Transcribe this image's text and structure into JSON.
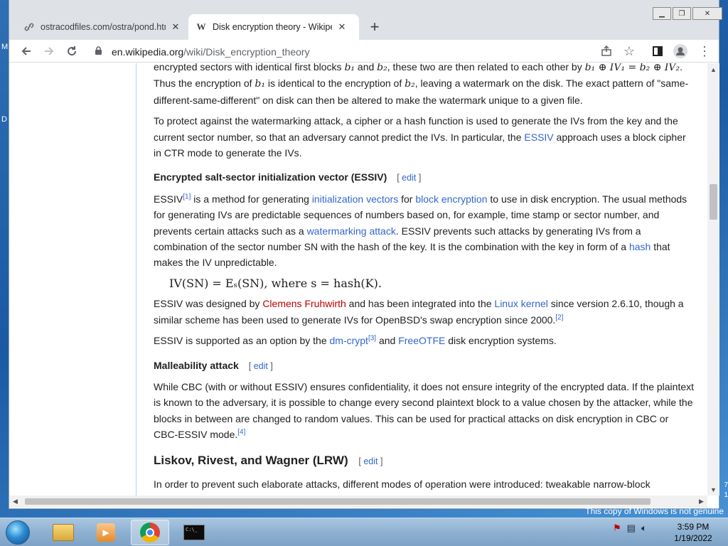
{
  "browser": {
    "tabs": [
      {
        "title": "ostracodfiles.com/ostra/pond.htm",
        "favicon": "link-icon"
      },
      {
        "title": "Disk encryption theory - Wikipedia",
        "favicon": "wikipedia-icon"
      }
    ],
    "new_tab": "+",
    "url_domain": "en.wikipedia.org",
    "url_path": "/wiki/Disk_encryption_theory"
  },
  "article": {
    "p0_a": "encrypted sectors with identical first blocks ",
    "p0_b": " and ",
    "p0_c": ", these two are then related to each other by ",
    "p0_eq": "b₁ ⊕ IV₁ = b₂ ⊕ IV₂",
    "p0_d": ". Thus the encryption of ",
    "p0_e": " is identical to the encryption of ",
    "p0_f": ", leaving a watermark on the disk. The exact pattern of \"same-different-same-different\" on disk can then be altered to make the watermark unique to a given file.",
    "b1": "b₁",
    "b2": "b₂",
    "p1_a": "To protect against the watermarking attack, a cipher or a hash function is used to generate the IVs from the key and the current sector number, so that an adversary cannot predict the IVs. In particular, the ",
    "p1_link": "ESSIV",
    "p1_b": " approach uses a block cipher in CTR mode to generate the IVs.",
    "h_essiv": "Encrypted salt-sector initialization vector (ESSIV)",
    "edit_open": "[",
    "edit_label": "edit",
    "edit_close": "]",
    "p2_a": "ESSIV",
    "p2_ref": "[1]",
    "p2_b": " is a method for generating ",
    "p2_link1": "initialization vectors",
    "p2_c": " for ",
    "p2_link2": "block encryption",
    "p2_d": " to use in disk encryption. The usual methods for generating IVs are predictable sequences of numbers based on, for example, time stamp or sector number, and prevents certain attacks such as a ",
    "p2_link3": "watermarking attack",
    "p2_e": ". ESSIV prevents such attacks by generating IVs from a combination of the sector number SN with the hash of the key. It is the combination with the key in form of a ",
    "p2_link4": "hash",
    "p2_f": " that makes the IV unpredictable.",
    "formula": "IV(SN) = Eₛ(SN),  where s = hash(K).",
    "p3_a": "ESSIV was designed by ",
    "p3_link1": "Clemens Fruhwirth",
    "p3_b": " and has been integrated into the ",
    "p3_link2": "Linux kernel",
    "p3_c": " since version 2.6.10, though a similar scheme has been used to generate IVs for OpenBSD's swap encryption since 2000.",
    "p3_ref": "[2]",
    "p4_a": "ESSIV is supported as an option by the ",
    "p4_link1": "dm-crypt",
    "p4_ref": "[3]",
    "p4_b": " and ",
    "p4_link2": "FreeOTFE",
    "p4_c": " disk encryption systems.",
    "h_malleability": "Malleability attack",
    "p5": "While CBC (with or without ESSIV) ensures confidentiality, it does not ensure integrity of the encrypted data. If the plaintext is known to the adversary, it is possible to change every second plaintext block to a value chosen by the attacker, while the blocks in between are changed to random values. This can be used for practical attacks on disk encryption in CBC or CBC-ESSIV mode.",
    "p5_ref": "[4]",
    "h_lrw": "Liskov, Rivest, and Wagner (LRW)",
    "p6": "In order to prevent such elaborate attacks, different modes of operation were introduced: tweakable narrow-block"
  },
  "desktop": {
    "edge_left_1": "M",
    "edge_left_2": "D",
    "edge_right_1": "7",
    "edge_right_2": "1",
    "notice": "This copy of Windows is not genuine"
  },
  "taskbar": {
    "time": "3:59 PM",
    "date": "1/19/2022",
    "cmd_label": "C:\\_"
  }
}
